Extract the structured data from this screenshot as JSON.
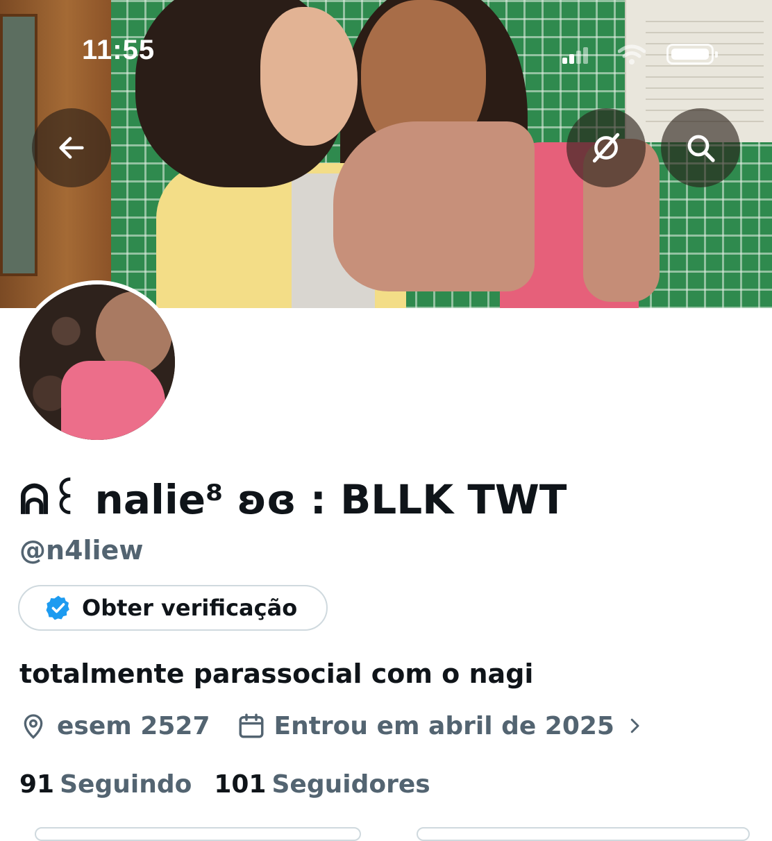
{
  "status_bar": {
    "time": "11:55"
  },
  "header": {
    "back_icon": "arrow-left-icon",
    "grok_icon": "grok-icon",
    "search_icon": "search-icon"
  },
  "profile": {
    "display_name": "ᕱ꒰ nalie⁸ ʚɞ : BLLK TWT",
    "handle": "@n4liew",
    "verify_button": "Obter verificação",
    "bio": "totalmente parassocial com o nagi",
    "location": "esem 2527",
    "joined": "Entrou em abril de 2025",
    "following_count": "91",
    "following_label": "Seguindo",
    "followers_count": "101",
    "followers_label": "Seguidores"
  },
  "colors": {
    "text_primary": "#0f1419",
    "text_secondary": "#536471",
    "verified_badge": "#1d9bf0",
    "border": "#cfd9de"
  }
}
